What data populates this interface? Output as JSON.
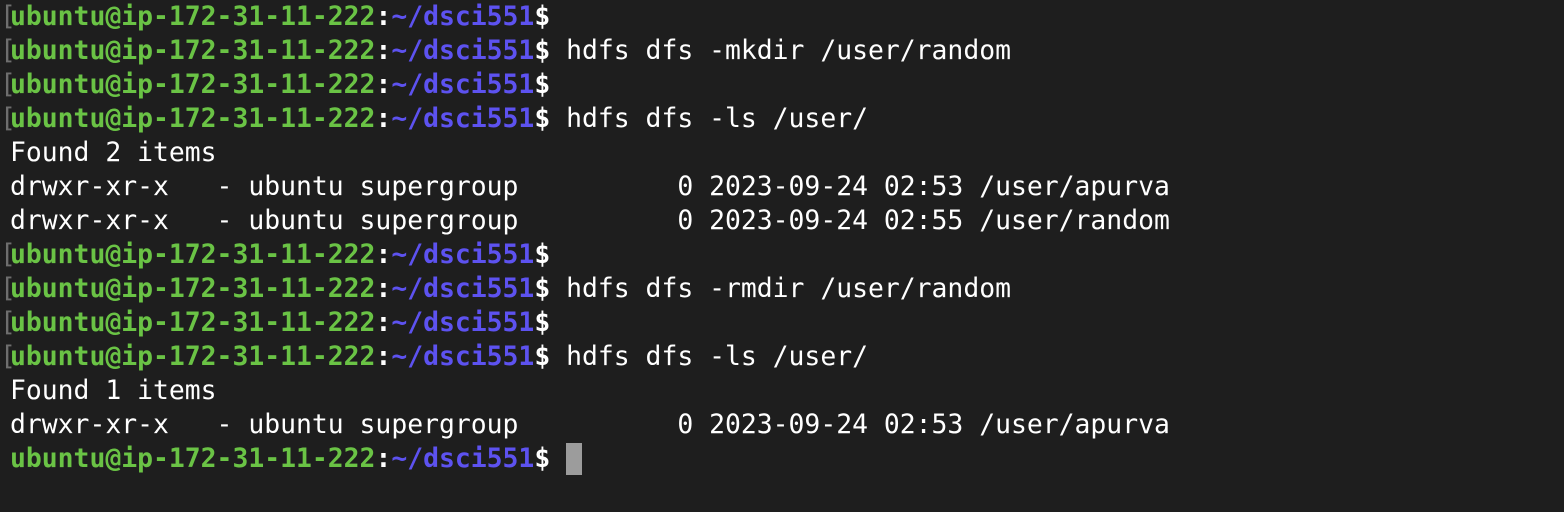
{
  "terminal": {
    "prompt": {
      "user_host": "ubuntu@ip-172-31-11-222",
      "colon": ":",
      "path": "~/dsci551",
      "dollar": "$",
      "marker": "["
    },
    "lines": [
      {
        "type": "prompt",
        "marked": true,
        "command": ""
      },
      {
        "type": "prompt",
        "marked": true,
        "command": " hdfs dfs -mkdir /user/random"
      },
      {
        "type": "prompt",
        "marked": true,
        "command": ""
      },
      {
        "type": "prompt",
        "marked": true,
        "command": " hdfs dfs -ls /user/"
      },
      {
        "type": "output",
        "text": "Found 2 items"
      },
      {
        "type": "output",
        "text": "drwxr-xr-x   - ubuntu supergroup          0 2023-09-24 02:53 /user/apurva"
      },
      {
        "type": "output",
        "text": "drwxr-xr-x   - ubuntu supergroup          0 2023-09-24 02:55 /user/random"
      },
      {
        "type": "prompt",
        "marked": true,
        "command": ""
      },
      {
        "type": "prompt",
        "marked": true,
        "command": " hdfs dfs -rmdir /user/random"
      },
      {
        "type": "prompt",
        "marked": true,
        "command": ""
      },
      {
        "type": "prompt",
        "marked": true,
        "command": " hdfs dfs -ls /user/"
      },
      {
        "type": "output",
        "text": "Found 1 items"
      },
      {
        "type": "output",
        "text": "drwxr-xr-x   - ubuntu supergroup          0 2023-09-24 02:53 /user/apurva"
      },
      {
        "type": "prompt",
        "marked": false,
        "command": " ",
        "cursor": true
      }
    ]
  }
}
